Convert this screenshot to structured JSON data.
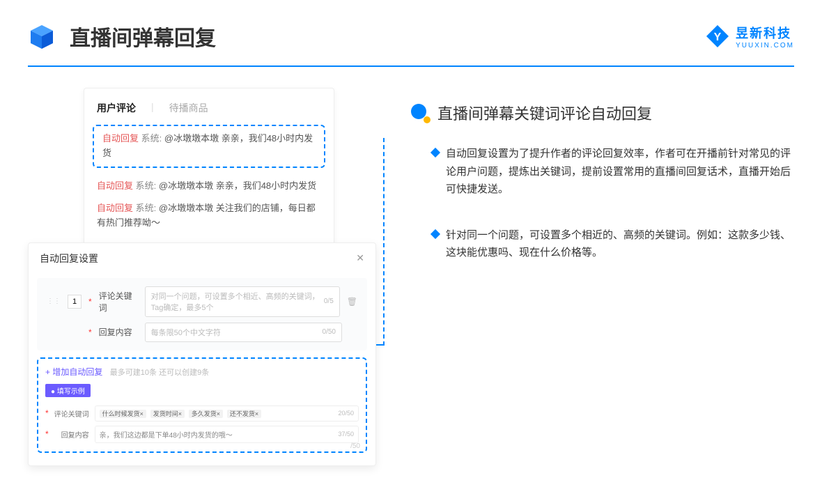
{
  "header": {
    "title": "直播间弹幕回复",
    "brand_name": "昱新科技",
    "brand_url": "YUUXIN.COM"
  },
  "comments_panel": {
    "tab_active": "用户评论",
    "tab_inactive": "待播商品",
    "auto_reply_label": "自动回复",
    "system_label": "系统:",
    "highlighted_msg": "@冰墩墩本墩 亲亲，我们48小时内发货",
    "msg2": "@冰墩墩本墩 亲亲，我们48小时内发货",
    "msg3": "@冰墩墩本墩 关注我们的店铺，每日都有热门推荐呦～"
  },
  "settings_modal": {
    "title": "自动回复设置",
    "index": "1",
    "keyword_label": "评论关键词",
    "keyword_placeholder": "对同一个问题，可设置多个相近、高频的关键词，Tag确定，最多5个",
    "keyword_counter": "0/5",
    "content_label": "回复内容",
    "content_placeholder": "每条限50个中文字符",
    "content_counter": "0/50",
    "add_link": "+ 增加自动回复",
    "add_hint": "最多可建10条 还可以创建9条",
    "example_badge": "● 填写示例",
    "ex_keyword_label": "评论关键词",
    "ex_tags": [
      "什么时候发货×",
      "发货时间×",
      "多久发货×",
      "还不发货×"
    ],
    "ex_keyword_counter": "20/50",
    "ex_content_label": "回复内容",
    "ex_content_value": "亲，我们这边都是下单48小时内发货的哦～",
    "ex_content_counter": "37/50",
    "float_counter": "/50"
  },
  "right": {
    "section_title": "直播间弹幕关键词评论自动回复",
    "bullet1": "自动回复设置为了提升作者的评论回复效率，作者可在开播前针对常见的评论用户问题，提炼出关键词，提前设置常用的直播间回复话术，直播开始后可快捷发送。",
    "bullet2": "针对同一个问题，可设置多个相近的、高频的关键词。例如：这款多少钱、这块能优惠吗、现在什么价格等。"
  }
}
